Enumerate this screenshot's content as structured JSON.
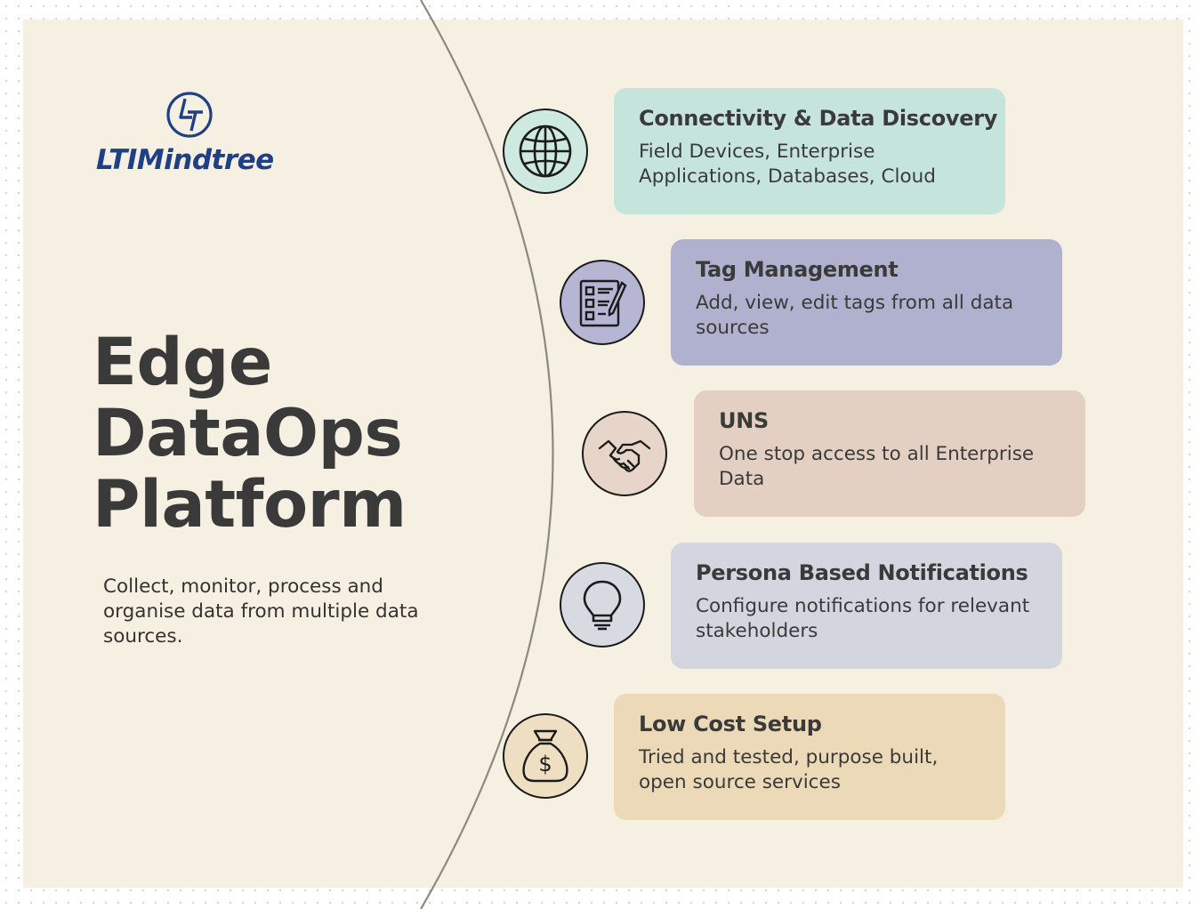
{
  "brand": {
    "name": "LTIMindtree",
    "logo_icon": "lt-logo-icon",
    "color": "#1f3f86"
  },
  "hero": {
    "title_lines": [
      "Edge",
      "DataOps",
      "Platform"
    ],
    "subtitle": "Collect, monitor, process and organise data from multiple data sources."
  },
  "features": [
    {
      "title": "Connectivity & Data Discovery",
      "description": "Field Devices, Enterprise Applications, Databases, Cloud",
      "icon": "globe-icon",
      "card_color": "#c5e5dc",
      "circle_color": "#cde9e0"
    },
    {
      "title": "Tag Management",
      "description": "Add, view, edit tags from all data sources",
      "icon": "checklist-icon",
      "card_color": "#b0b0cf",
      "circle_color": "#b6b6d4"
    },
    {
      "title": "UNS",
      "description": "One stop access to all Enterprise Data",
      "icon": "handshake-icon",
      "card_color": "#e3d0c3",
      "circle_color": "#e6d5c8"
    },
    {
      "title": "Persona Based Notifications",
      "description": "Configure notifications for relevant stakeholders",
      "icon": "lightbulb-icon",
      "card_color": "#d3d6de",
      "circle_color": "#d8dae2"
    },
    {
      "title": "Low Cost Setup",
      "description": "Tried and tested, purpose built, open source services",
      "icon": "money-bag-icon",
      "card_color": "#ecd9b7",
      "circle_color": "#efdfc2"
    }
  ]
}
